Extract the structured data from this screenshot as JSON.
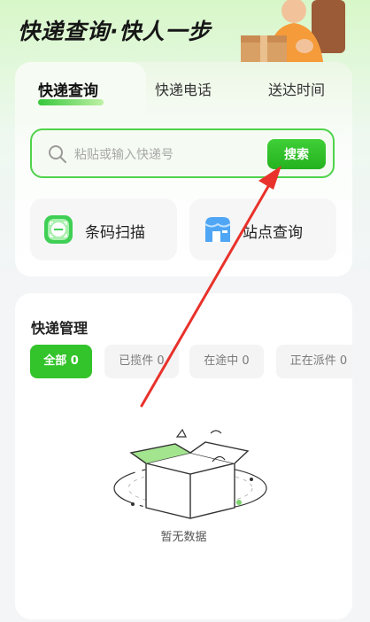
{
  "hero": {
    "slogan": "快递查询·快人一步"
  },
  "tabs": [
    {
      "label": "快递查询",
      "active": true
    },
    {
      "label": "快递电话",
      "active": false
    },
    {
      "label": "送达时间",
      "active": false
    }
  ],
  "search": {
    "placeholder": "粘贴或输入快递号",
    "button_label": "搜索"
  },
  "shortcuts": [
    {
      "label": "条码扫描",
      "icon": "barcode-scan-icon"
    },
    {
      "label": "站点查询",
      "icon": "station-icon"
    }
  ],
  "manage": {
    "title": "快递管理",
    "filters": [
      {
        "label": "全部 0",
        "active": true
      },
      {
        "label": "已揽件 0",
        "active": false
      },
      {
        "label": "在途中 0",
        "active": false
      },
      {
        "label": "正在派件 0",
        "active": false
      }
    ],
    "empty_text": "暂无数据"
  },
  "colors": {
    "accent": "#33c32a",
    "accent_border": "#4fd34a",
    "annotation_arrow": "#e8322b"
  }
}
